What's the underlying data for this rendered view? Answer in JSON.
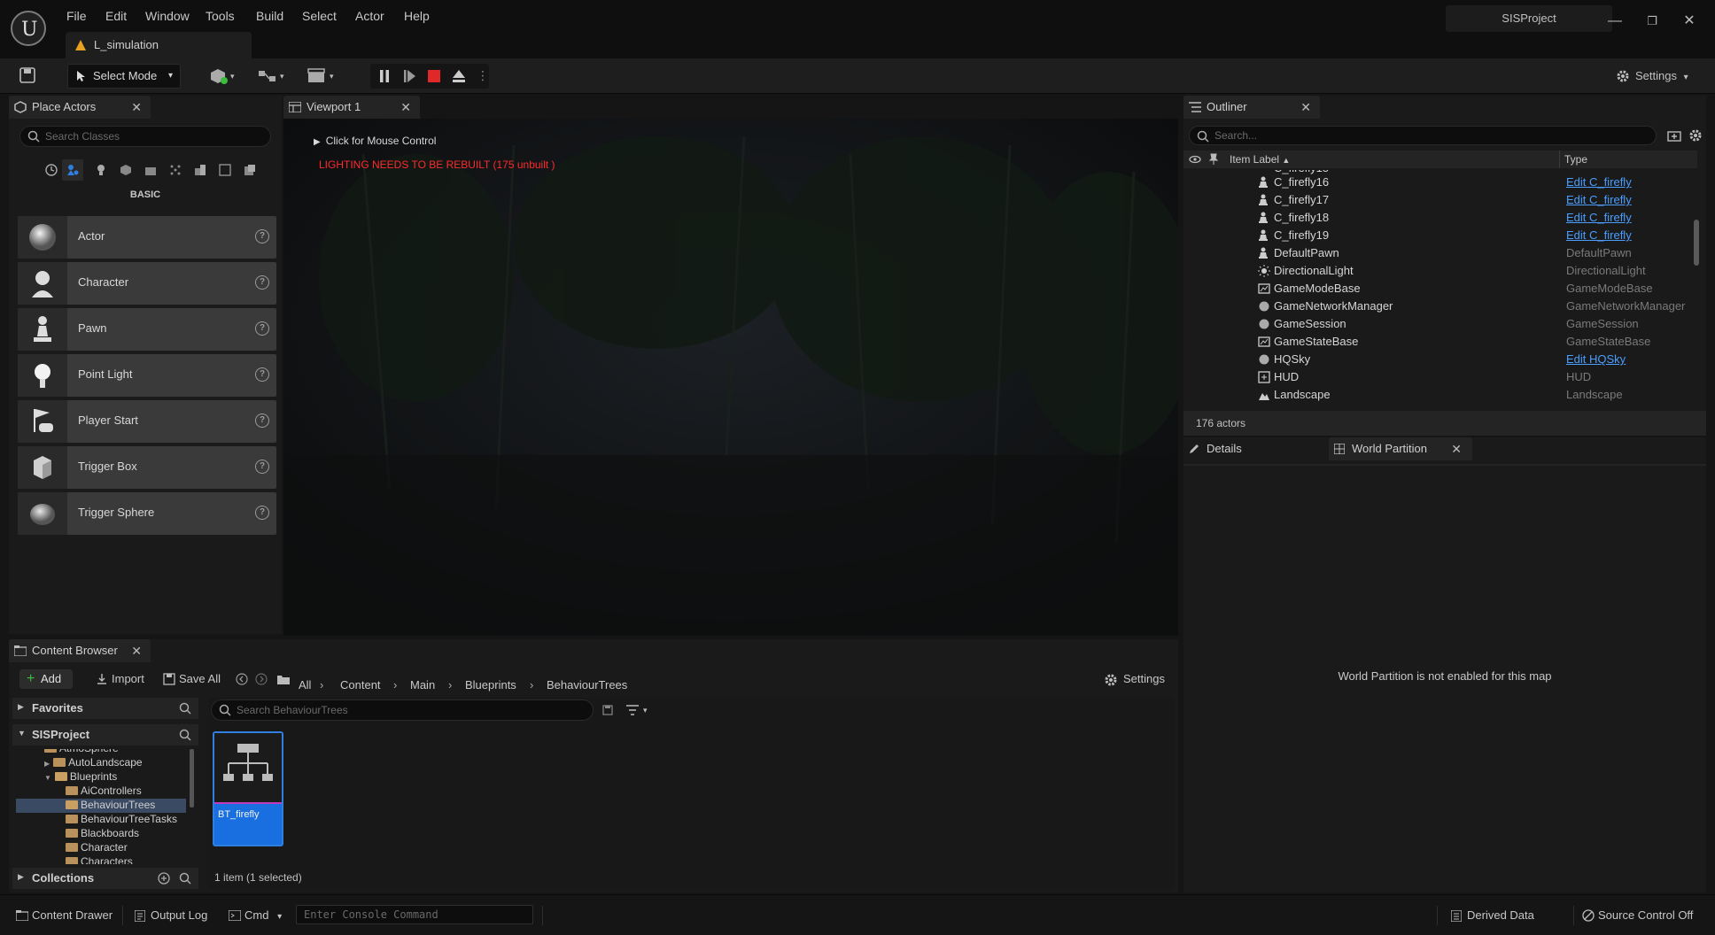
{
  "app": {
    "project_name": "SISProject",
    "level_tab": "L_simulation"
  },
  "menu": [
    "File",
    "Edit",
    "Window",
    "Tools",
    "Build",
    "Select",
    "Actor",
    "Help"
  ],
  "window_controls": {
    "minimize": "—",
    "restore": "❐",
    "close": "✕"
  },
  "toolbar": {
    "select_mode": "Select Mode",
    "settings": "Settings"
  },
  "place_actors": {
    "tab": "Place Actors",
    "search_placeholder": "Search Classes",
    "category": "BASIC",
    "items": [
      {
        "label": "Actor",
        "icon": "sphere-icon"
      },
      {
        "label": "Character",
        "icon": "character-icon"
      },
      {
        "label": "Pawn",
        "icon": "pawn-icon"
      },
      {
        "label": "Point Light",
        "icon": "light-bulb-icon"
      },
      {
        "label": "Player Start",
        "icon": "player-start-icon"
      },
      {
        "label": "Trigger Box",
        "icon": "cube-icon"
      },
      {
        "label": "Trigger Sphere",
        "icon": "sphere-icon"
      }
    ]
  },
  "viewport": {
    "tab": "Viewport 1",
    "mouse_control": "Click for Mouse Control",
    "warning": "LIGHTING NEEDS TO BE REBUILT (175 unbuilt )",
    "warning_color": "#ff2a2a"
  },
  "outliner": {
    "tab": "Outliner",
    "search_placeholder": "Search...",
    "col_label": "Item Label",
    "col_type": "Type",
    "rows": [
      {
        "name": "C_firefly16",
        "type": "Edit C_firefly",
        "link": true
      },
      {
        "name": "C_firefly17",
        "type": "Edit C_firefly",
        "link": true
      },
      {
        "name": "C_firefly18",
        "type": "Edit C_firefly",
        "link": true
      },
      {
        "name": "C_firefly19",
        "type": "Edit C_firefly",
        "link": true
      },
      {
        "name": "DefaultPawn",
        "type": "DefaultPawn",
        "link": false
      },
      {
        "name": "DirectionalLight",
        "type": "DirectionalLight",
        "link": false
      },
      {
        "name": "GameModeBase",
        "type": "GameModeBase",
        "link": false
      },
      {
        "name": "GameNetworkManager",
        "type": "GameNetworkManager",
        "link": false
      },
      {
        "name": "GameSession",
        "type": "GameSession",
        "link": false
      },
      {
        "name": "GameStateBase",
        "type": "GameStateBase",
        "link": false
      },
      {
        "name": "HQSky",
        "type": "Edit HQSky",
        "link": true
      },
      {
        "name": "HUD",
        "type": "HUD",
        "link": false
      },
      {
        "name": "Landscape",
        "type": "Landscape",
        "link": false
      }
    ],
    "count": "176 actors"
  },
  "details": {
    "tab_details": "Details",
    "tab_world_partition": "World Partition",
    "message": "World Partition is not enabled for this map"
  },
  "content_browser": {
    "tab": "Content Browser",
    "add": "Add",
    "import": "Import",
    "save_all": "Save All",
    "breadcrumbs": [
      "All",
      "Content",
      "Main",
      "Blueprints",
      "BehaviourTrees"
    ],
    "settings": "Settings",
    "favorites": "Favorites",
    "project": "SISProject",
    "collections": "Collections",
    "search_placeholder": "Search BehaviourTrees",
    "tree": [
      {
        "label": "AutoLandscape",
        "indent": 1
      },
      {
        "label": "Blueprints",
        "indent": 1
      },
      {
        "label": "AiControllers",
        "indent": 2
      },
      {
        "label": "BehaviourTrees",
        "indent": 2
      },
      {
        "label": "BehaviourTreeTasks",
        "indent": 2
      },
      {
        "label": "Blackboards",
        "indent": 2
      },
      {
        "label": "Character",
        "indent": 2
      }
    ],
    "asset": {
      "name": "BT_firefly"
    },
    "item_count": "1 item (1 selected)"
  },
  "statusbar": {
    "content_drawer": "Content Drawer",
    "output_log": "Output Log",
    "cmd": "Cmd",
    "console_placeholder": "Enter Console Command",
    "derived_data": "Derived Data",
    "source_control": "Source Control Off"
  }
}
